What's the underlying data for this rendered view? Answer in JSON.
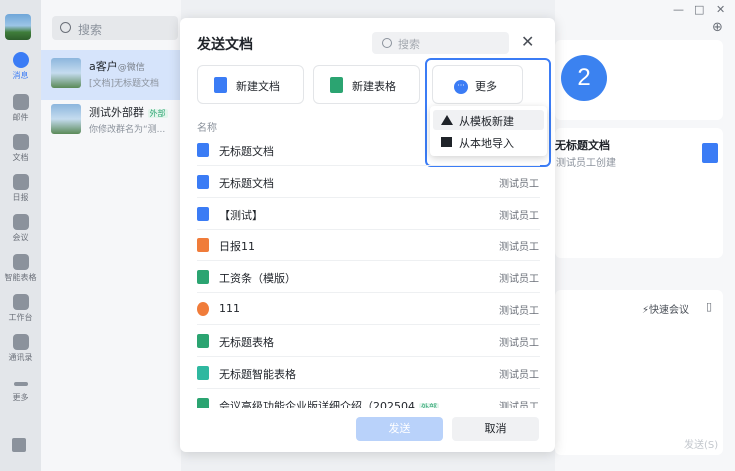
{
  "rail": {
    "items": [
      {
        "label": "消息",
        "icon": "chat-icon"
      },
      {
        "label": "邮件",
        "icon": "mail-icon"
      },
      {
        "label": "文档",
        "icon": "doc-icon"
      },
      {
        "label": "日报",
        "icon": "calendar-icon"
      },
      {
        "label": "会议",
        "icon": "meeting-icon"
      },
      {
        "label": "智能表格",
        "icon": "smart-table-icon"
      },
      {
        "label": "工作台",
        "icon": "workbench-icon"
      },
      {
        "label": "通讯录",
        "icon": "contacts-icon"
      },
      {
        "label": "更多",
        "icon": "more-icon"
      }
    ]
  },
  "convlist": {
    "search_placeholder": "搜索",
    "items": [
      {
        "name": "a客户",
        "suffix": "@微信",
        "snippet": "[文档]无标题文档"
      },
      {
        "name": "测试外部群",
        "tag": "外部",
        "snippet": "你修改群名为“测..."
      }
    ]
  },
  "right": {
    "doc_title": "无标题文档",
    "doc_sub": "测试员工创建",
    "quick_meeting": "快速会议",
    "send_label": "发送(S)",
    "badge": "2"
  },
  "modal": {
    "title": "发送文档",
    "search_placeholder": "搜索",
    "new_doc": "新建文档",
    "new_sheet": "新建表格",
    "more": "更多",
    "menu": [
      "从模板新建",
      "从本地导入"
    ],
    "col_name": "名称",
    "rows": [
      {
        "name": "无标题文档",
        "owner": "",
        "color": "#3b7cf5"
      },
      {
        "name": "无标题文档",
        "owner": "测试员工",
        "color": "#3b7cf5"
      },
      {
        "name": "【测试】",
        "owner": "测试员工",
        "color": "#3b7cf5"
      },
      {
        "name": "日报11",
        "owner": "测试员工",
        "color": "#f07c3a"
      },
      {
        "name": "工资条（模版）",
        "owner": "测试员工",
        "color": "#2ba471"
      },
      {
        "name": "111",
        "owner": "测试员工",
        "color": "#f07c3a"
      },
      {
        "name": "无标题表格",
        "owner": "测试员工",
        "color": "#2ba471"
      },
      {
        "name": "无标题智能表格",
        "owner": "测试员工",
        "color": "#2fb8a0"
      },
      {
        "name": "会议高级功能企业版详细介绍（202504",
        "owner": "测试员工",
        "color": "#2ba471",
        "tag": "外部"
      }
    ],
    "send": "发送",
    "cancel": "取消"
  }
}
